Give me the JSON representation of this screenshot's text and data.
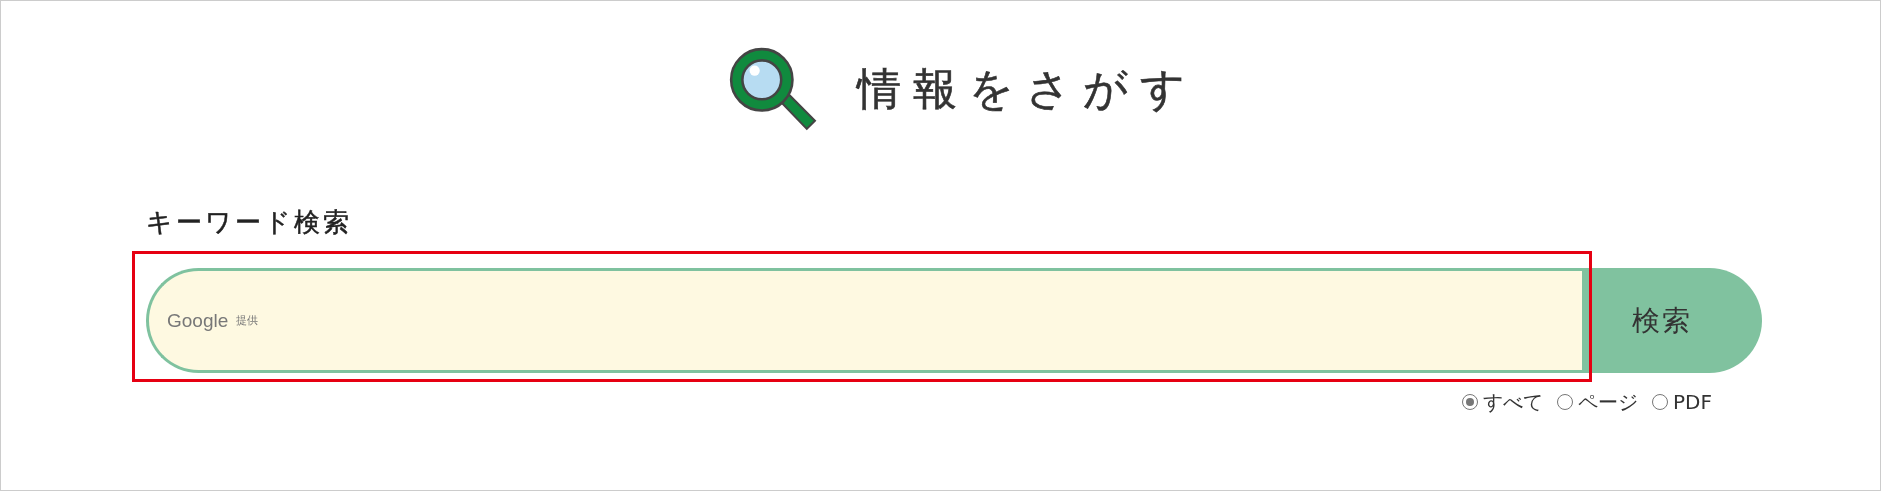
{
  "heading": {
    "title": "情報をさがす"
  },
  "search": {
    "label": "キーワード検索",
    "branding": "Google",
    "branding_note": "提供",
    "highlighted": true,
    "button": "検索"
  },
  "scopes": [
    {
      "label": "すべて",
      "selected": true
    },
    {
      "label": "ページ",
      "selected": false
    },
    {
      "label": "PDF",
      "selected": false
    }
  ]
}
